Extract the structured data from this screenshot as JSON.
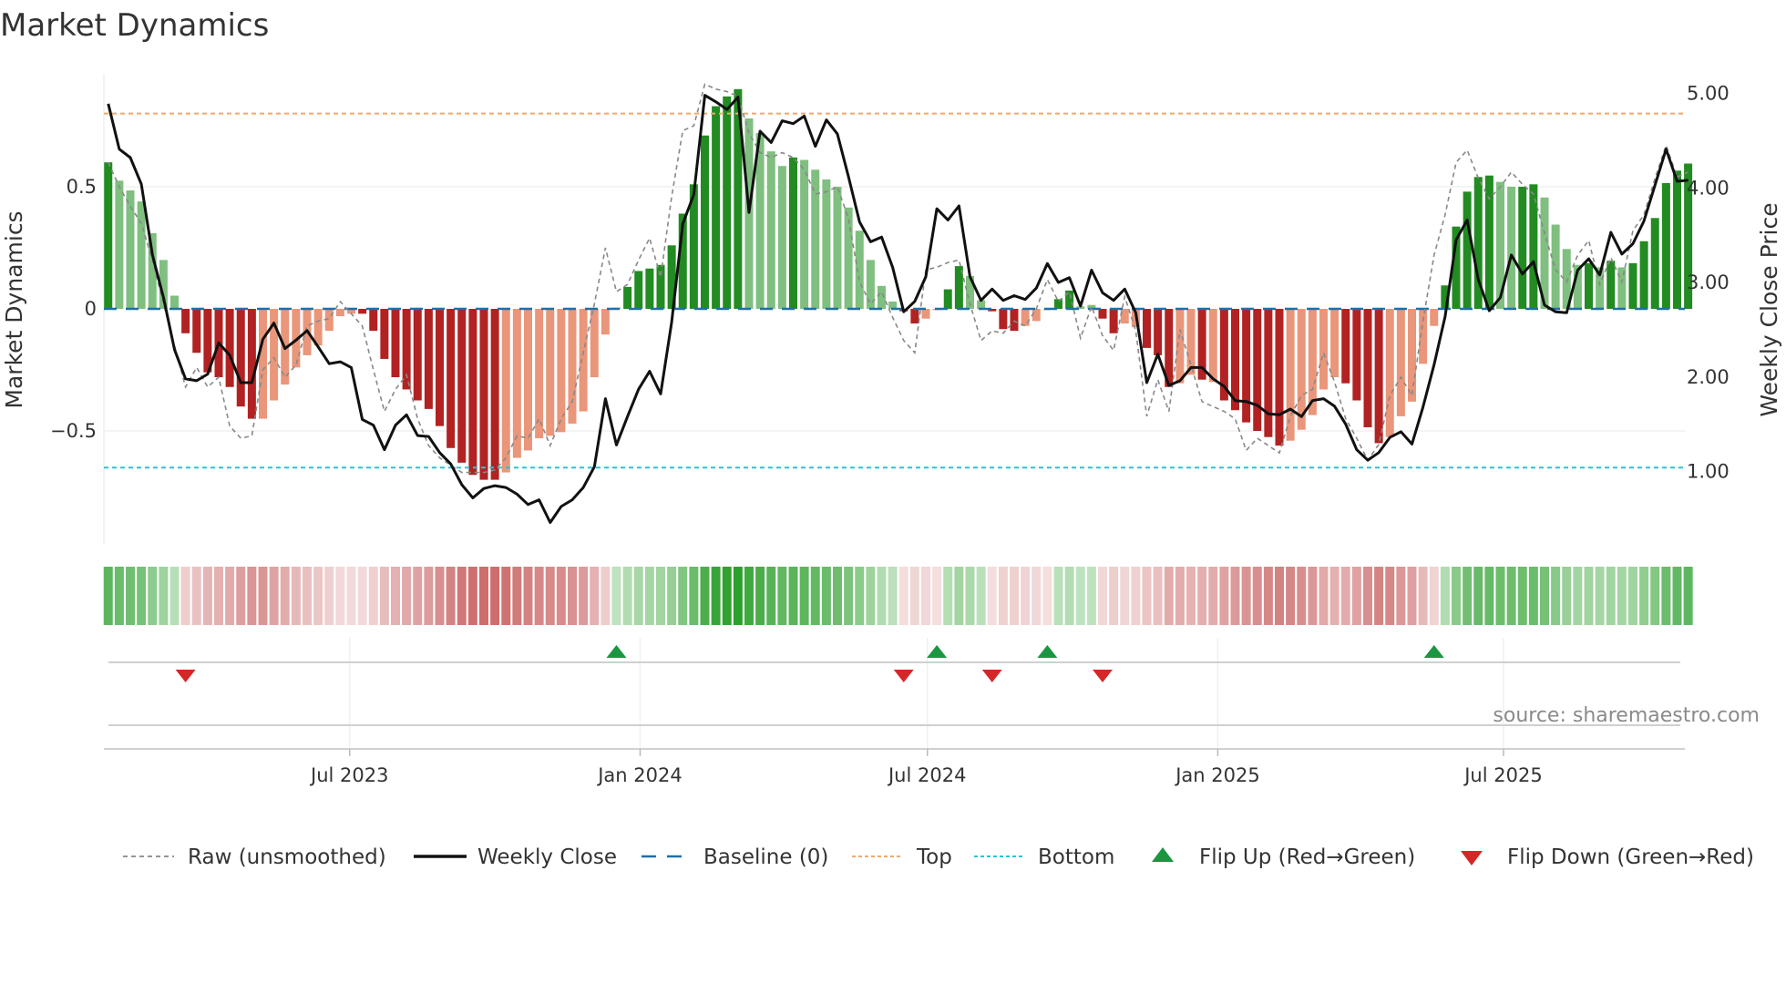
{
  "title": "Market Dynamics",
  "source": "source: sharemaestro.com",
  "colors": {
    "strong_up": "#228B22",
    "weak_up": "#7fbf7f",
    "strong_down": "#b22222",
    "weak_down": "#e9967a",
    "close": "#111111",
    "raw": "#888888",
    "baseline": "#1f6fa8",
    "top": "#f0a868",
    "bottom": "#29c4d4",
    "flip_up": "#1a9641",
    "flip_down": "#d62728"
  },
  "legend": [
    {
      "key": "raw",
      "label": "Raw (unsmoothed)"
    },
    {
      "key": "close",
      "label": "Weekly Close"
    },
    {
      "key": "baseline",
      "label": "Baseline (0)"
    },
    {
      "key": "top",
      "label": "Top"
    },
    {
      "key": "bottom",
      "label": "Bottom"
    },
    {
      "key": "flip_up",
      "label": "Flip Up (Red→Green)"
    },
    {
      "key": "flip_down",
      "label": "Flip Down (Green→Red)"
    }
  ],
  "chart_data": {
    "type": "bar",
    "title": "Market Dynamics",
    "ylabel": "Market Dynamics",
    "y2label": "Weekly Close Price",
    "ylim": [
      -0.88,
      1.0
    ],
    "y2lim": [
      0.2,
      5.5
    ],
    "yticks": [
      {
        "v": 0.5,
        "label": "0.5"
      },
      {
        "v": 0,
        "label": "0"
      },
      {
        "v": -0.5,
        "label": "−0.5"
      }
    ],
    "y2ticks": [
      {
        "v": 5,
        "label": "5.00"
      },
      {
        "v": 4,
        "label": "4.00"
      },
      {
        "v": 3,
        "label": "3.00"
      },
      {
        "v": 2,
        "label": "2.00"
      },
      {
        "v": 1,
        "label": "1.00"
      }
    ],
    "xticks": [
      {
        "date": "2023-07-01",
        "label": "Jul 2023"
      },
      {
        "date": "2024-01-01",
        "label": "Jan 2024"
      },
      {
        "date": "2024-07-01",
        "label": "Jul 2024"
      },
      {
        "date": "2025-01-01",
        "label": "Jan 2025"
      },
      {
        "date": "2025-07-01",
        "label": "Jul 2025"
      }
    ],
    "start_date": "2023-01-29",
    "frequency": "weekly",
    "top_level": 0.8,
    "bottom_level": -0.65,
    "baseline": 0,
    "grid": true,
    "legend_position": "bottom",
    "bar_state_codes": "GggggggRRRRRRRrrrrrrrrrRRRRRRRRRRRRRrrrrrrrrrrgGGGGGGGGGGGggggGgggggggggRRrrGGggRRRrrrGGggRRrrRRRrrRrRRRRRRrrrrrRRRRrrrrrGGGGGggGGggggGgGgGGGGGG",
    "bar_state_legend": {
      "G": "strong_up",
      "g": "weak_up",
      "R": "strong_down",
      "r": "weak_down"
    },
    "dynamics": [
      0.6,
      0.525,
      0.485,
      0.44,
      0.31,
      0.2,
      0.054,
      -0.1,
      -0.18,
      -0.26,
      -0.28,
      -0.32,
      -0.4,
      -0.45,
      -0.45,
      -0.375,
      -0.31,
      -0.24,
      -0.19,
      -0.15,
      -0.09,
      -0.03,
      -0.02,
      -0.02,
      -0.09,
      -0.205,
      -0.28,
      -0.33,
      -0.375,
      -0.41,
      -0.48,
      -0.57,
      -0.63,
      -0.68,
      -0.7,
      -0.7,
      -0.67,
      -0.61,
      -0.58,
      -0.53,
      -0.52,
      -0.505,
      -0.47,
      -0.42,
      -0.28,
      -0.105,
      0.005,
      0.09,
      0.155,
      0.165,
      0.18,
      0.26,
      0.39,
      0.51,
      0.71,
      0.83,
      0.87,
      0.9,
      0.78,
      0.72,
      0.645,
      0.585,
      0.62,
      0.61,
      0.57,
      0.53,
      0.5,
      0.415,
      0.32,
      0.2,
      0.094,
      0.03,
      -0.01,
      -0.06,
      -0.04,
      -0.005,
      0.08,
      0.175,
      0.135,
      0.035,
      -0.01,
      -0.083,
      -0.09,
      -0.07,
      -0.05,
      -0.005,
      0.04,
      0.075,
      0.01,
      0.016,
      -0.04,
      -0.1,
      -0.06,
      -0.075,
      -0.16,
      -0.19,
      -0.32,
      -0.305,
      -0.27,
      -0.29,
      -0.3,
      -0.375,
      -0.415,
      -0.465,
      -0.5,
      -0.525,
      -0.56,
      -0.54,
      -0.495,
      -0.435,
      -0.33,
      -0.28,
      -0.305,
      -0.375,
      -0.485,
      -0.55,
      -0.525,
      -0.44,
      -0.38,
      -0.225,
      -0.07,
      0.096,
      0.337,
      0.48,
      0.54,
      0.546,
      0.52,
      0.5,
      0.5,
      0.51,
      0.456,
      0.345,
      0.245,
      0.18,
      0.187,
      0.17,
      0.197,
      0.17,
      0.187,
      0.277,
      0.372,
      0.515,
      0.566,
      0.595
    ],
    "raw": [
      0.6,
      0.5,
      0.42,
      0.35,
      0.2,
      0.02,
      -0.15,
      -0.32,
      -0.24,
      -0.32,
      -0.28,
      -0.48,
      -0.53,
      -0.52,
      -0.25,
      -0.2,
      -0.28,
      -0.23,
      -0.07,
      -0.05,
      -0.04,
      0.03,
      -0.02,
      -0.07,
      -0.25,
      -0.42,
      -0.33,
      -0.27,
      -0.45,
      -0.56,
      -0.61,
      -0.64,
      -0.67,
      -0.67,
      -0.67,
      -0.66,
      -0.61,
      -0.52,
      -0.53,
      -0.45,
      -0.56,
      -0.45,
      -0.38,
      -0.18,
      0.02,
      0.25,
      0.07,
      0.1,
      0.2,
      0.29,
      0.13,
      0.46,
      0.73,
      0.75,
      0.92,
      0.9,
      0.89,
      0.87,
      0.72,
      0.64,
      0.62,
      0.64,
      0.62,
      0.57,
      0.47,
      0.48,
      0.5,
      0.37,
      0.11,
      0.02,
      0.07,
      -0.035,
      -0.13,
      -0.18,
      0.16,
      0.17,
      0.19,
      0.2,
      0.02,
      -0.13,
      -0.09,
      -0.1,
      -0.05,
      -0.07,
      0.0,
      0.12,
      0.03,
      0.07,
      -0.12,
      0.01,
      -0.11,
      -0.17,
      0.05,
      -0.09,
      -0.44,
      -0.29,
      -0.42,
      -0.085,
      -0.23,
      -0.38,
      -0.4,
      -0.42,
      -0.45,
      -0.58,
      -0.53,
      -0.56,
      -0.59,
      -0.44,
      -0.355,
      -0.33,
      -0.18,
      -0.3,
      -0.45,
      -0.53,
      -0.62,
      -0.555,
      -0.355,
      -0.28,
      -0.355,
      -0.05,
      0.22,
      0.385,
      0.6,
      0.65,
      0.535,
      0.45,
      0.5,
      0.56,
      0.51,
      0.47,
      0.31,
      0.16,
      0.11,
      0.22,
      0.28,
      0.1,
      0.21,
      0.11,
      0.32,
      0.385,
      0.535,
      0.67,
      0.54,
      0.56
    ],
    "weekly_close": [
      4.89,
      4.41,
      4.32,
      4.04,
      3.29,
      2.84,
      2.29,
      1.98,
      1.96,
      2.03,
      2.36,
      2.23,
      1.94,
      1.94,
      2.4,
      2.57,
      2.3,
      2.39,
      2.49,
      2.32,
      2.14,
      2.16,
      2.1,
      1.55,
      1.49,
      1.23,
      1.49,
      1.6,
      1.38,
      1.37,
      1.2,
      1.08,
      0.86,
      0.72,
      0.82,
      0.85,
      0.83,
      0.76,
      0.65,
      0.7,
      0.46,
      0.63,
      0.7,
      0.83,
      1.05,
      1.77,
      1.28,
      1.58,
      1.87,
      2.06,
      1.82,
      2.58,
      3.62,
      3.93,
      4.98,
      4.91,
      4.83,
      4.96,
      3.74,
      4.6,
      4.48,
      4.71,
      4.68,
      4.76,
      4.44,
      4.72,
      4.57,
      4.12,
      3.64,
      3.43,
      3.48,
      3.16,
      2.69,
      2.8,
      3.06,
      3.78,
      3.66,
      3.81,
      3.06,
      2.81,
      2.93,
      2.81,
      2.86,
      2.82,
      2.94,
      3.2,
      3.0,
      3.05,
      2.75,
      3.13,
      2.89,
      2.81,
      2.93,
      2.68,
      1.94,
      2.24,
      1.91,
      1.96,
      2.1,
      2.1,
      1.98,
      1.9,
      1.75,
      1.74,
      1.7,
      1.61,
      1.6,
      1.66,
      1.58,
      1.75,
      1.77,
      1.69,
      1.5,
      1.23,
      1.12,
      1.2,
      1.36,
      1.42,
      1.29,
      1.68,
      2.13,
      2.64,
      3.45,
      3.66,
      3.03,
      2.7,
      2.84,
      3.29,
      3.09,
      3.22,
      2.76,
      2.69,
      2.68,
      3.13,
      3.25,
      3.08,
      3.53,
      3.3,
      3.41,
      3.65,
      4.03,
      4.41,
      4.07,
      4.08
    ],
    "flip_up_dates": [
      "2023-12-17",
      "2024-07-07",
      "2024-09-15",
      "2025-05-18"
    ],
    "flip_down_dates": [
      "2023-03-19",
      "2024-06-16",
      "2024-08-11",
      "2024-10-20"
    ]
  }
}
